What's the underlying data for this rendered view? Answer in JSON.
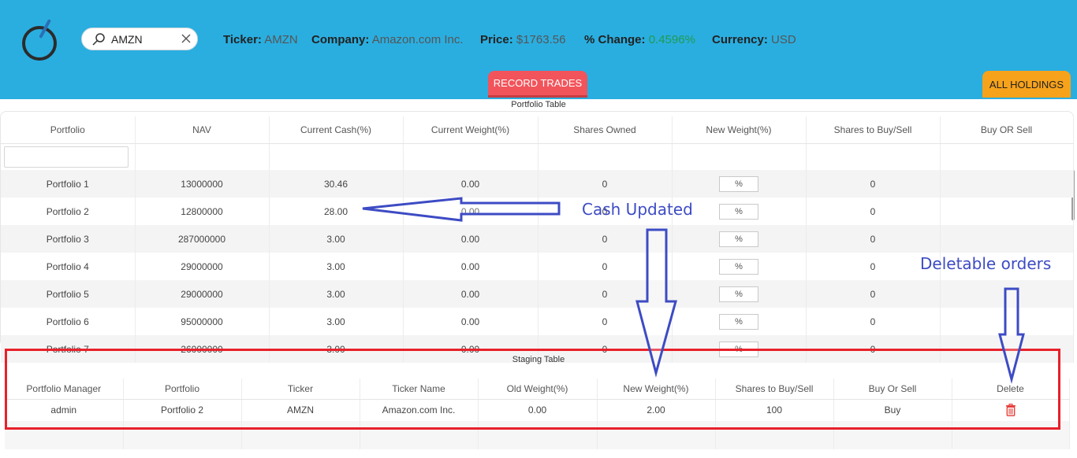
{
  "header": {
    "search_value": "AMZN",
    "ticker_label": "Ticker:",
    "ticker_value": "AMZN",
    "company_label": "Company:",
    "company_value": "Amazon.com Inc.",
    "price_label": "Price:",
    "price_value": "$1763.56",
    "change_label": "% Change:",
    "change_value": "0.4596%",
    "currency_label": "Currency:",
    "currency_value": "USD",
    "tab_record": "RECORD TRADES",
    "tab_all": "ALL HOLDINGS"
  },
  "portfolio_table": {
    "title": "Portfolio Table",
    "columns": [
      "Portfolio",
      "NAV",
      "Current Cash(%)",
      "Current Weight(%)",
      "Shares Owned",
      "New Weight(%)",
      "Shares to Buy/Sell",
      "Buy OR Sell"
    ],
    "pct_placeholder": "%",
    "rows": [
      {
        "portfolio": "Portfolio 1",
        "nav": "13000000",
        "cash": "30.46",
        "weight": "0.00",
        "shares": "0",
        "to_buy": "0"
      },
      {
        "portfolio": "Portfolio 2",
        "nav": "12800000",
        "cash": "28.00",
        "weight": "0.00",
        "shares": "0",
        "to_buy": "0"
      },
      {
        "portfolio": "Portfolio 3",
        "nav": "287000000",
        "cash": "3.00",
        "weight": "0.00",
        "shares": "0",
        "to_buy": "0"
      },
      {
        "portfolio": "Portfolio 4",
        "nav": "29000000",
        "cash": "3.00",
        "weight": "0.00",
        "shares": "0",
        "to_buy": "0"
      },
      {
        "portfolio": "Portfolio 5",
        "nav": "29000000",
        "cash": "3.00",
        "weight": "0.00",
        "shares": "0",
        "to_buy": "0"
      },
      {
        "portfolio": "Portfolio 6",
        "nav": "95000000",
        "cash": "3.00",
        "weight": "0.00",
        "shares": "0",
        "to_buy": "0"
      },
      {
        "portfolio": "Portfolio 7",
        "nav": "26000000",
        "cash": "3.00",
        "weight": "0.00",
        "shares": "0",
        "to_buy": "0"
      }
    ]
  },
  "staging_table": {
    "title": "Staging Table",
    "columns": [
      "Portfolio Manager",
      "Portfolio",
      "Ticker",
      "Ticker Name",
      "Old Weight(%)",
      "New Weight(%)",
      "Shares to Buy/Sell",
      "Buy Or Sell",
      "Delete"
    ],
    "rows": [
      {
        "manager": "admin",
        "portfolio": "Portfolio 2",
        "ticker": "AMZN",
        "name": "Amazon.com Inc.",
        "old_weight": "0.00",
        "new_weight": "2.00",
        "shares": "100",
        "side": "Buy"
      }
    ]
  },
  "annotations": {
    "cash_updated": "Cash Updated",
    "deletable_orders": "Deletable orders"
  },
  "colors": {
    "header_bg": "#2aaee0",
    "record_tab": "#f2545b",
    "all_tab": "#f7a21b",
    "positive_change": "#1f9b4f",
    "annotation": "#3d4bc4",
    "highlight_box": "#e8202a",
    "delete_icon": "#e53935"
  }
}
